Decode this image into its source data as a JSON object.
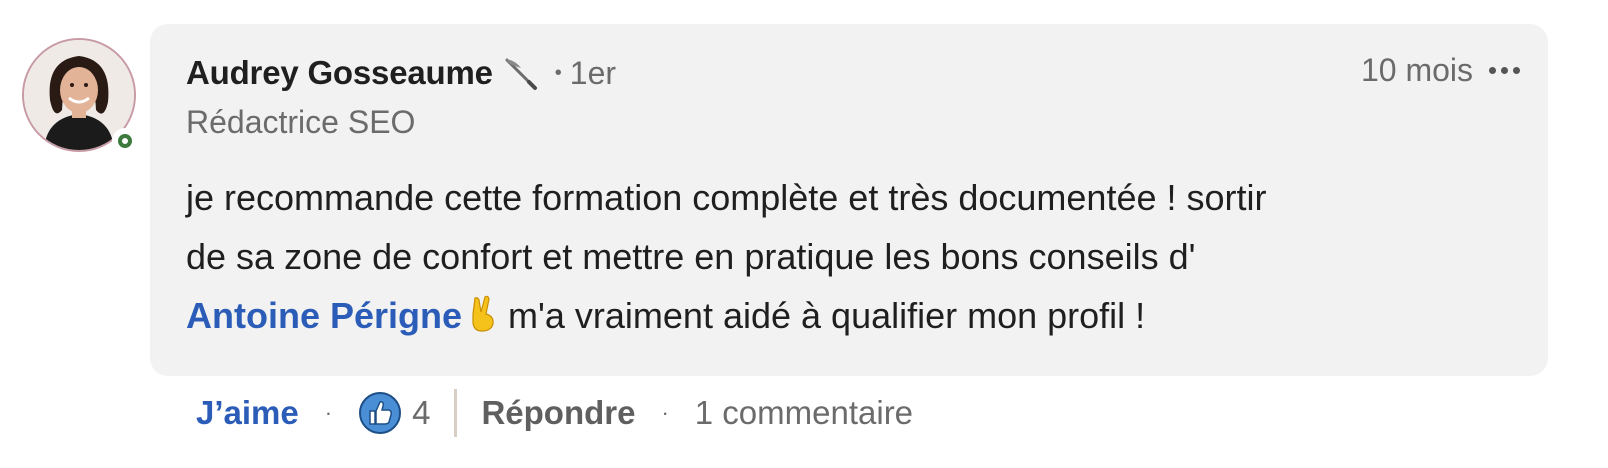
{
  "comment": {
    "author": {
      "name": "Audrey Gosseaume",
      "icon": "quill-pen-icon",
      "degree": "1er",
      "headline": "Rédactrice SEO",
      "presence": "online",
      "presence_color": "#3c7a3e"
    },
    "separator": "•",
    "timestamp": "10 mois",
    "text": {
      "line1": "je recommande cette formation complète et très documentée ! sortir",
      "line2": "de sa zone de confort et mettre en pratique les bons conseils d'",
      "mention": "Antoine Périgne",
      "mention_emoji": "victory-hand-icon",
      "tail": "m'a vraiment aidé à qualifier mon profil !"
    }
  },
  "actions": {
    "like_label": "J’aime",
    "separator": "·",
    "reaction_icon": "like-reaction-icon",
    "reaction_count": "4",
    "reply_label": "Répondre",
    "replies_label": "1 commentaire"
  },
  "colors": {
    "link": "#2a5cb8",
    "bubble": "#f2f2f2",
    "muted": "#6b6b6b"
  }
}
